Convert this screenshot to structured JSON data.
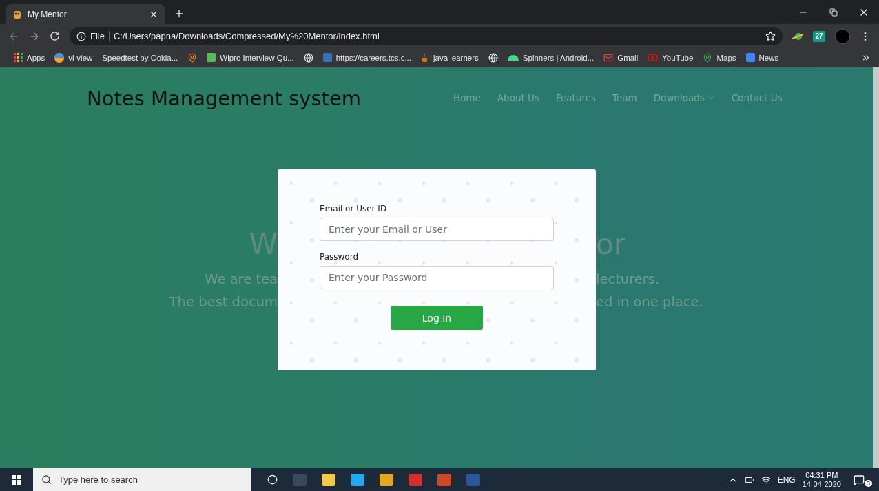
{
  "browser": {
    "tab": {
      "title": "My Mentor",
      "selected": true
    },
    "address": {
      "scheme": "File",
      "url": "C:/Users/papna/Downloads/Compressed/My%20Mentor/index.html"
    },
    "extension_badge": "27",
    "bookmarks": [
      {
        "kind": "apps",
        "label": "Apps"
      },
      {
        "kind": "ball",
        "label": "vi-view"
      },
      {
        "kind": "plain",
        "label": "Speedtest by Ookla..."
      },
      {
        "kind": "pin"
      },
      {
        "kind": "wipro",
        "label": "Wipro Interview Qu..."
      },
      {
        "kind": "globe"
      },
      {
        "kind": "tcs",
        "label": "https://careers.tcs.c..."
      },
      {
        "kind": "java",
        "label": "java learners"
      },
      {
        "kind": "globe"
      },
      {
        "kind": "android",
        "label": "Spinners | Android..."
      },
      {
        "kind": "gmail",
        "label": "Gmail"
      },
      {
        "kind": "youtube",
        "label": "YouTube"
      },
      {
        "kind": "maps",
        "label": "Maps"
      },
      {
        "kind": "news",
        "label": "News"
      }
    ]
  },
  "site": {
    "brand": "Notes Management system",
    "nav": [
      {
        "label": "Home",
        "kind": "link"
      },
      {
        "label": "About Us",
        "kind": "link"
      },
      {
        "label": "Features",
        "kind": "link"
      },
      {
        "label": "Team",
        "kind": "link"
      },
      {
        "label": "Downloads",
        "kind": "dropdown"
      },
      {
        "label": "Contact Us",
        "kind": "link"
      }
    ],
    "hero": {
      "heading": {
        "left": "W",
        "right": "or"
      },
      "lines": [
        {
          "left": "We are tea",
          "right": "lecturers."
        },
        {
          "left": "The best docum",
          "right": "ed in one place."
        }
      ]
    },
    "login": {
      "email_label": "Email or User ID",
      "email_placeholder": "Enter your Email or User",
      "password_label": "Password",
      "password_placeholder": "Enter your Password",
      "button": "Log In"
    }
  },
  "taskbar": {
    "search_placeholder": "Type here to search",
    "language": "ENG",
    "time": "04:31 PM",
    "date": "14-04-2020",
    "notifications": "3"
  }
}
